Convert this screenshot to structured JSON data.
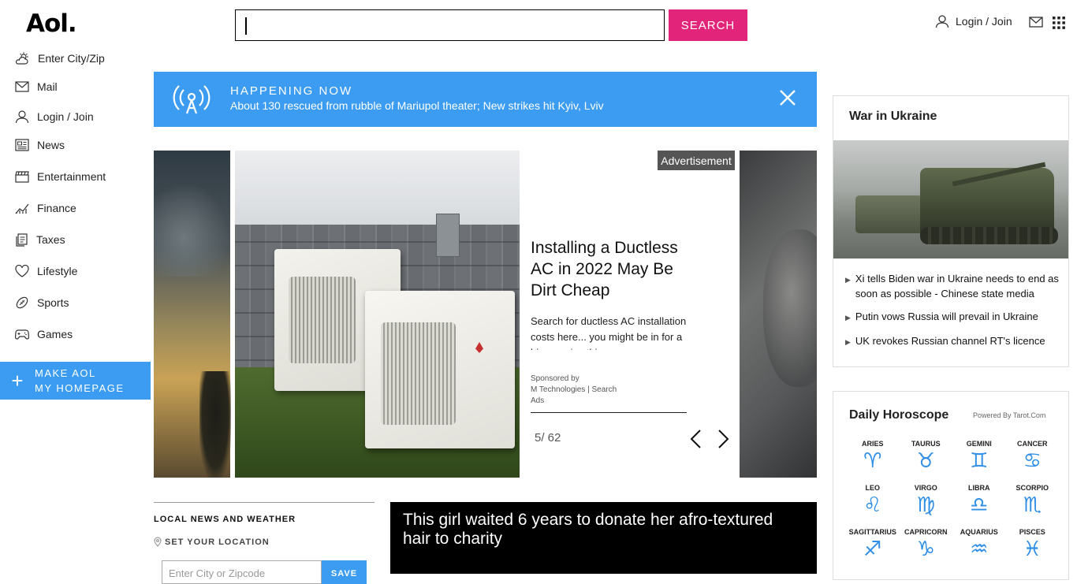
{
  "header": {
    "logo": "Aol.",
    "search_placeholder": "",
    "search_button": "SEARCH",
    "login_label": "Login / Join"
  },
  "sidebar": {
    "items": [
      {
        "label": "Enter City/Zip",
        "icon": "weather-icon"
      },
      {
        "label": "Mail",
        "icon": "mail-icon"
      },
      {
        "label": "Login / Join",
        "icon": "user-icon"
      },
      {
        "label": "News",
        "icon": "news-icon"
      },
      {
        "label": "Entertainment",
        "icon": "clapper-icon"
      },
      {
        "label": "Finance",
        "icon": "chart-icon"
      },
      {
        "label": "Taxes",
        "icon": "documents-icon"
      },
      {
        "label": "Lifestyle",
        "icon": "heart-icon"
      },
      {
        "label": "Sports",
        "icon": "football-icon"
      },
      {
        "label": "Games",
        "icon": "gamepad-icon"
      }
    ],
    "make_homepage_line1": "MAKE AOL",
    "make_homepage_line2": "MY HOMEPAGE"
  },
  "happening": {
    "kicker": "HAPPENING NOW",
    "headline": "About 130 rescued from rubble of Mariupol theater; New strikes hit Kyiv, Lviv"
  },
  "carousel": {
    "ad_badge": "Advertisement",
    "title": "Installing a Ductless AC in 2022 May Be Dirt Cheap",
    "description": "Search for ductless AC installation costs here... you might be in for a big surprise this",
    "sponsored_line1": "Sponsored by",
    "sponsored_line2": "M Technologies | Search Ads",
    "counter": "5/ 62"
  },
  "local": {
    "title": "LOCAL NEWS AND WEATHER",
    "set_location": "SET YOUR LOCATION",
    "input_placeholder": "Enter City or Zipcode",
    "save": "SAVE"
  },
  "video": {
    "title": "This girl waited 6 years to donate her afro-textured hair to charity"
  },
  "ukraine": {
    "title": "War in Ukraine",
    "headlines": [
      "Xi tells Biden war in Ukraine needs to end as soon as possible - Chinese state media",
      "Putin vows Russia will prevail in Ukraine",
      "UK revokes Russian channel RT's licence"
    ]
  },
  "horoscope": {
    "title": "Daily Horoscope",
    "powered_by": "Powered By Tarot.Com",
    "signs": [
      {
        "name": "ARIES",
        "glyph": "♈"
      },
      {
        "name": "TAURUS",
        "glyph": "♉"
      },
      {
        "name": "GEMINI",
        "glyph": "♊"
      },
      {
        "name": "CANCER",
        "glyph": "♋"
      },
      {
        "name": "LEO",
        "glyph": "♌"
      },
      {
        "name": "VIRGO",
        "glyph": "♍"
      },
      {
        "name": "LIBRA",
        "glyph": "♎"
      },
      {
        "name": "SCORPIO",
        "glyph": "♏"
      },
      {
        "name": "SAGITTARIUS",
        "glyph": "♐"
      },
      {
        "name": "CAPRICORN",
        "glyph": "♑"
      },
      {
        "name": "AQUARIUS",
        "glyph": "♒"
      },
      {
        "name": "PISCES",
        "glyph": "♓"
      }
    ]
  },
  "colors": {
    "brand_blue": "#3b9cf1",
    "search_pink": "#e2257a",
    "zodiac_blue": "#2f8ee6"
  }
}
